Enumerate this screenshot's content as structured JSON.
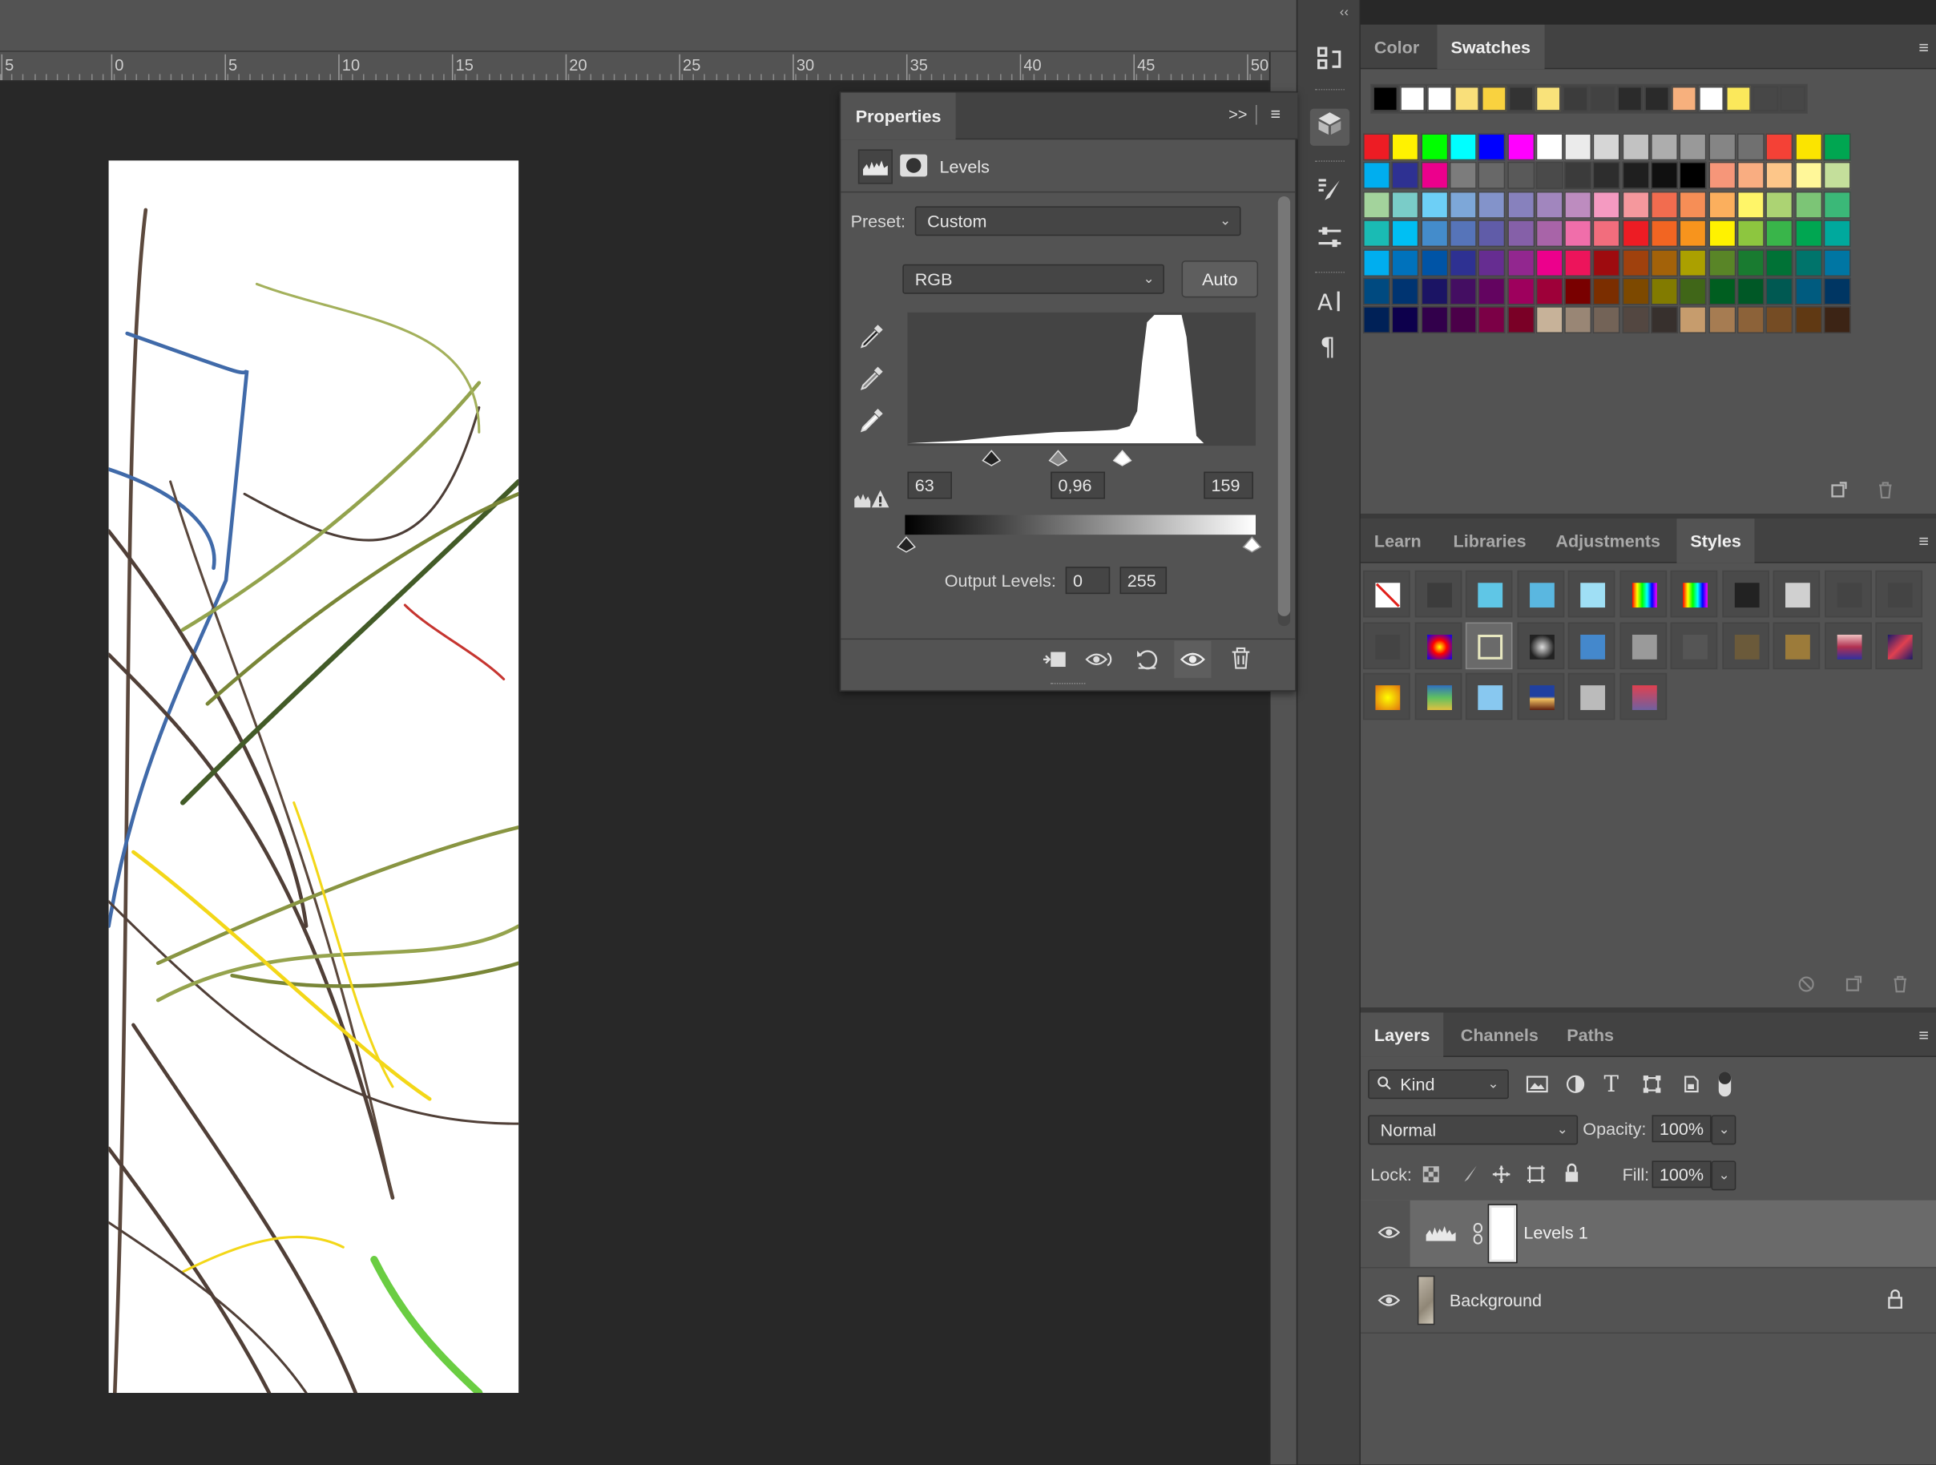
{
  "ruler": {
    "labels": [
      "5",
      "0",
      "5",
      "10",
      "15",
      "20",
      "25",
      "30",
      "35",
      "40",
      "45",
      "50"
    ]
  },
  "toolcol": {
    "collapse_glyph": "‹‹",
    "icons": [
      "history-icon",
      "3d-icon",
      "brush-settings-icon",
      "adjustments-icon",
      "character-icon",
      "paragraph-icon"
    ]
  },
  "properties": {
    "tab_label": "Properties",
    "expand_glyph": ">>",
    "adjustment_name": "Levels",
    "preset_label": "Preset:",
    "preset_value": "Custom",
    "channel_value": "RGB",
    "auto_label": "Auto",
    "input_black": "63",
    "input_gamma": "0,96",
    "input_white": "159",
    "output_label": "Output Levels:",
    "output_black": "0",
    "output_white": "255"
  },
  "colorpanel": {
    "tabs": [
      "Color",
      "Swatches"
    ],
    "active_tab": "Swatches",
    "recent_swatches": [
      "#000000",
      "#ffffff",
      "#ffffff",
      "#f9df7a",
      "#f9d23f",
      "#333333",
      "#f9e27a",
      "#3c3c3c",
      "#424242",
      "#2b2b2b",
      "#2a2a2a",
      "#f7b07d",
      "#ffffff",
      "#fbe85b",
      "#474747",
      "#474747"
    ],
    "swatch_rows": [
      [
        "#ed1c24",
        "#fff200",
        "#00ff00",
        "#00ffff",
        "#0000ff",
        "#ff00ff",
        "#ffffff",
        "#ebebeb",
        "#d6d6d6",
        "#c2c2c2",
        "#adadad",
        "#999999",
        "#858585",
        "#707070",
        "#f44136",
        "#fbe400",
        "#00a651"
      ],
      [
        "#00aeef",
        "#2e3192",
        "#ec008c",
        "#7c7c7c",
        "#686868",
        "#595959",
        "#4a4a4a",
        "#3b3b3b",
        "#2d2d2d",
        "#1f1f1f",
        "#101010",
        "#000000",
        "#f69679",
        "#f9ad81",
        "#fdc689",
        "#fff799",
        "#c4df9b"
      ],
      [
        "#a3d39c",
        "#7accc8",
        "#6dcff6",
        "#7da7d8",
        "#8393ca",
        "#8781bd",
        "#a186be",
        "#bd8cbf",
        "#f49ac1",
        "#f5989d",
        "#f26c4f",
        "#f68e56",
        "#fbaf5d",
        "#fff568",
        "#acd373",
        "#7cc576",
        "#3bb878"
      ],
      [
        "#1abbb4",
        "#00bff3",
        "#448ccb",
        "#5674b9",
        "#605ca8",
        "#8560a8",
        "#a864a8",
        "#f06eaa",
        "#f26d7d",
        "#ed1c24",
        "#f26522",
        "#f7941d",
        "#fff200",
        "#8dc63f",
        "#39b54a",
        "#00a651",
        "#00a99d"
      ],
      [
        "#00aeef",
        "#0072bc",
        "#0054a6",
        "#2e3192",
        "#662d91",
        "#92278f",
        "#ec008c",
        "#ed145b",
        "#9e0b0f",
        "#a0410d",
        "#a36209",
        "#aba000",
        "#598527",
        "#197b30",
        "#007236",
        "#00746b",
        "#0076a3"
      ],
      [
        "#004a80",
        "#003471",
        "#1b1464",
        "#440e62",
        "#630460",
        "#9e005d",
        "#9e0039",
        "#790000",
        "#7b2e00",
        "#7d4900",
        "#827b00",
        "#406618",
        "#005e20",
        "#005826",
        "#005952",
        "#005b7f",
        "#003663"
      ],
      [
        "#002157",
        "#0d004c",
        "#32004b",
        "#4b0049",
        "#7b0046",
        "#7a0026",
        "#c7b299",
        "#998675",
        "#736357",
        "#534741",
        "#37302d",
        "#c69c6d",
        "#a67c52",
        "#8c6239",
        "#754c24",
        "#603913",
        "#3c2415"
      ]
    ]
  },
  "librariespanel": {
    "tabs": [
      "Learn",
      "Libraries",
      "Adjustments",
      "Styles"
    ],
    "active_tab": "Styles",
    "style_colors": [
      [
        "#ffffff",
        "#3c3c3c",
        "#5fc6e6",
        "#5ab7e0",
        "#9fdff5",
        "#ffffff",
        "#d02090",
        "#222222",
        "#d0d0d0",
        "#444444",
        "#444444"
      ],
      [
        "#444444",
        "#ff4500",
        "#6a6a6a",
        "#222222",
        "#4488cc",
        "#9a9a9a",
        "#555555",
        "#6b5a3a",
        "#9c7b3a",
        "#b03050",
        "#8b2a7a"
      ],
      [
        "#e08010",
        "#40a060",
        "#88c8f0",
        "#2050a0",
        "#bbbbbb",
        "#c04060"
      ]
    ]
  },
  "layerspanel": {
    "tabs": [
      "Layers",
      "Channels",
      "Paths"
    ],
    "active_tab": "Layers",
    "filter_kind": "Kind",
    "blend_mode": "Normal",
    "opacity_label": "Opacity:",
    "opacity_value": "100%",
    "lock_label": "Lock:",
    "fill_label": "Fill:",
    "fill_value": "100%",
    "layers": [
      {
        "name": "Levels 1",
        "selected": true
      },
      {
        "name": "Background",
        "selected": false
      }
    ]
  }
}
